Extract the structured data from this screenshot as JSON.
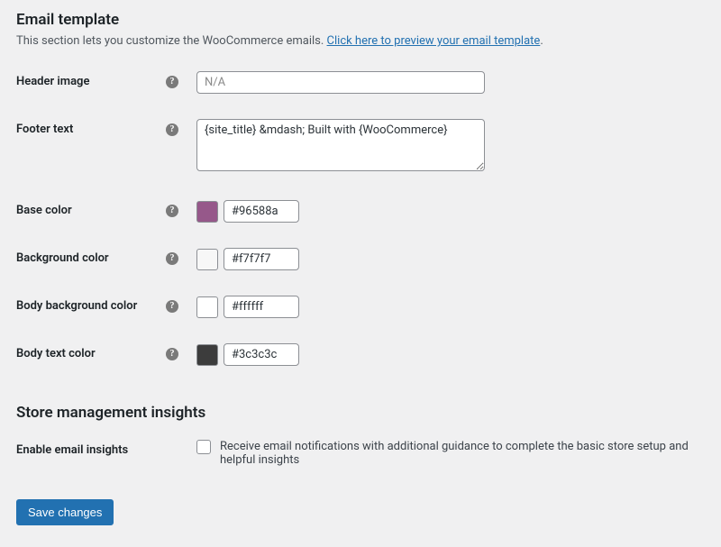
{
  "section1": {
    "heading": "Email template",
    "desc_pre": "This section lets you customize the WooCommerce emails. ",
    "desc_link": "Click here to preview your email template",
    "desc_post": "."
  },
  "fields": {
    "header_image": {
      "label": "Header image",
      "placeholder": "N/A",
      "value": ""
    },
    "footer_text": {
      "label": "Footer text",
      "value": "{site_title} &mdash; Built with {WooCommerce}"
    },
    "base_color": {
      "label": "Base color",
      "value": "#96588a"
    },
    "bg_color": {
      "label": "Background color",
      "value": "#f7f7f7"
    },
    "body_bg": {
      "label": "Body background color",
      "value": "#ffffff"
    },
    "body_text": {
      "label": "Body text color",
      "value": "#3c3c3c"
    }
  },
  "section2": {
    "heading": "Store management insights",
    "insights_label": "Enable email insights",
    "insights_desc": "Receive email notifications with additional guidance to complete the basic store setup and helpful insights",
    "insights_checked": false
  },
  "submit_label": "Save changes"
}
